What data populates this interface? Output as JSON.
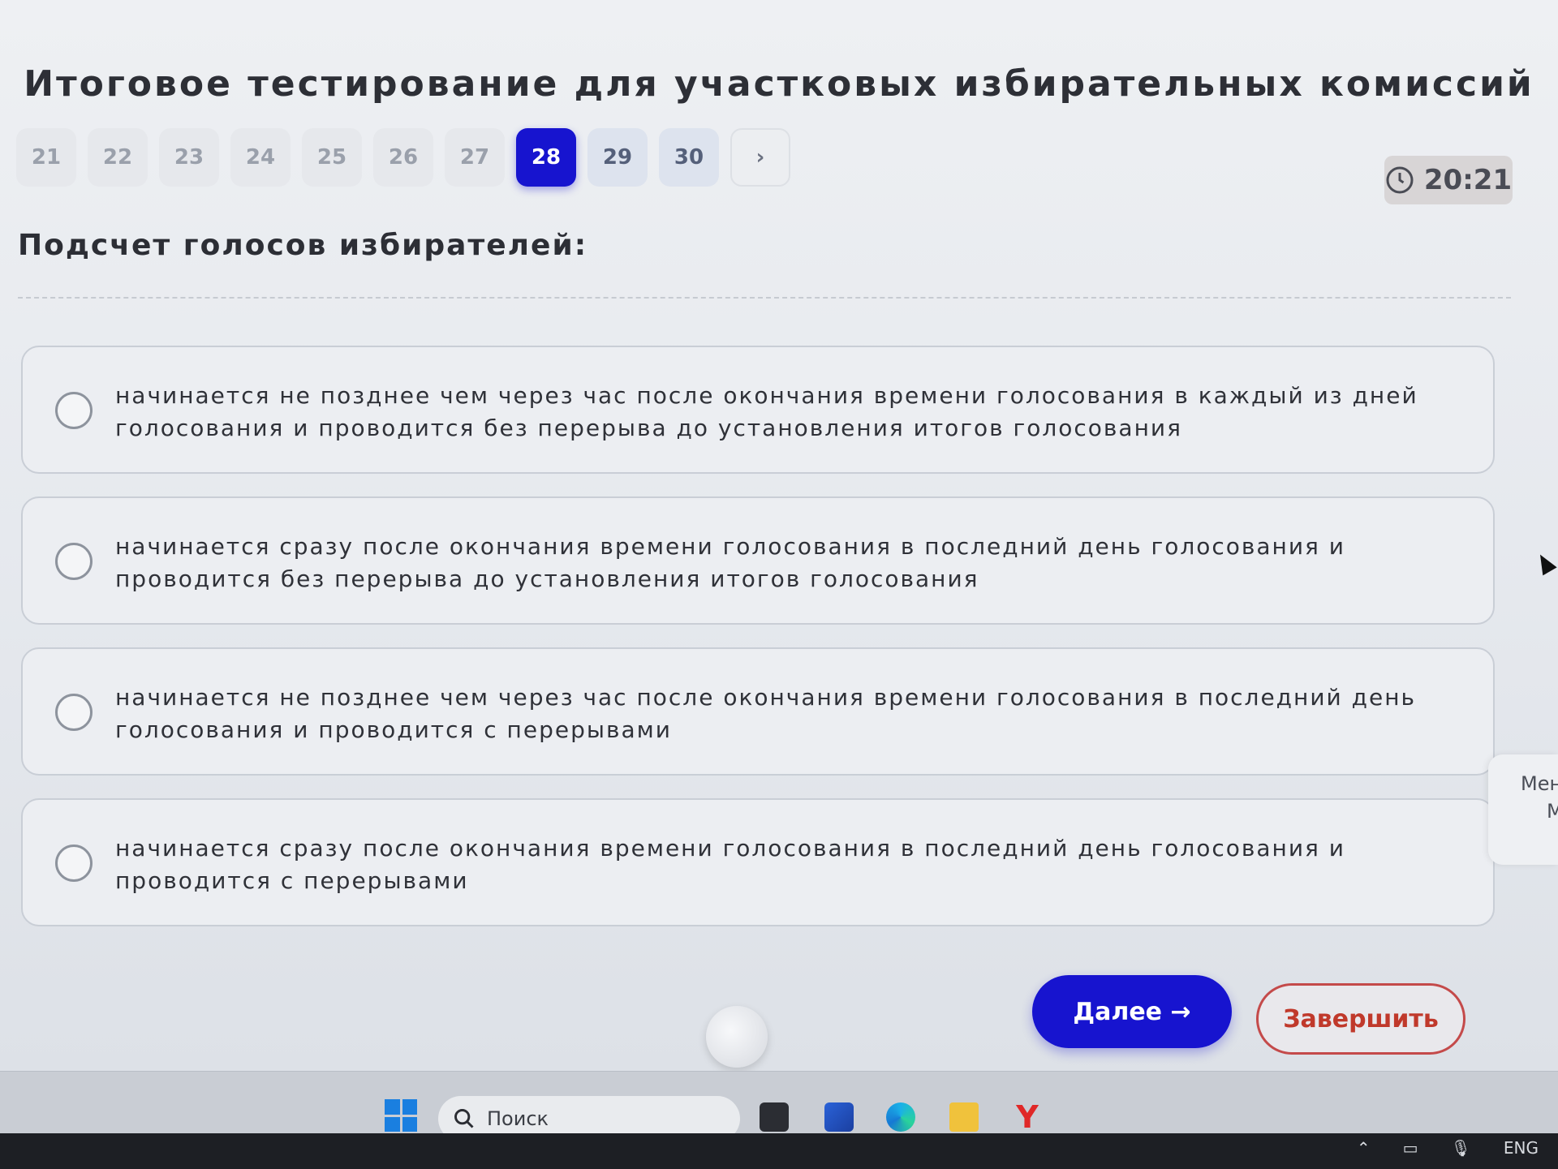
{
  "title": "Итоговое тестирование для участковых избирательных комиссий",
  "nav": {
    "questions": [
      {
        "label": "21",
        "state": "done"
      },
      {
        "label": "22",
        "state": "done"
      },
      {
        "label": "23",
        "state": "done"
      },
      {
        "label": "24",
        "state": "done"
      },
      {
        "label": "25",
        "state": "done"
      },
      {
        "label": "26",
        "state": "done"
      },
      {
        "label": "27",
        "state": "done"
      },
      {
        "label": "28",
        "state": "active"
      },
      {
        "label": "29",
        "state": "todo"
      },
      {
        "label": "30",
        "state": "todo"
      }
    ],
    "next_arrow": "›"
  },
  "timer": {
    "value": "20:21",
    "icon": "clock-icon"
  },
  "question": {
    "text": "Подсчет голосов избирателей:"
  },
  "options": [
    {
      "text": "начинается не позднее чем через час после окончания времени голосования в каждый из дней голосования и проводится без перерыва до установления итогов голосования"
    },
    {
      "text": "начинается сразу после окончания времени голосования в последний день голосования и проводится без перерыва до установления итогов голосования"
    },
    {
      "text": "начинается не позднее чем через час после окончания времени голосования в последний день голосования и проводится с перерывами"
    },
    {
      "text": "начинается сразу после окончания времени голосования в последний день голосования и проводится с перерывами"
    }
  ],
  "actions": {
    "next_label": "Далее →",
    "finish_label": "Завершить"
  },
  "side_panel": {
    "label": "Мен",
    "label2": "М"
  },
  "taskbar": {
    "search_placeholder": "Поиск",
    "language": "ENG",
    "yandex_letter": "Y"
  },
  "colors": {
    "accent": "#1714cf",
    "finish": "#c44a4a"
  }
}
